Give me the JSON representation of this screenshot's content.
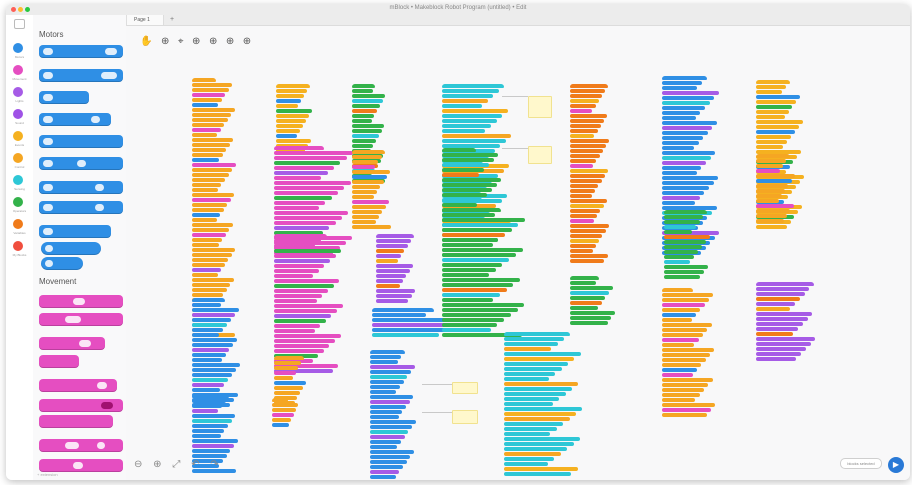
{
  "window": {
    "title": "mBlock • Makeblock Robot Program (untitled) • Edit",
    "traffic_lights": [
      "#ff5f57",
      "#febc2e",
      "#28c840"
    ]
  },
  "tabs": [
    {
      "label": "Page 1"
    }
  ],
  "add_tab_label": "+",
  "categories": [
    {
      "label": "Motors",
      "color": "#2f8fe5"
    },
    {
      "label": "Movement",
      "color": "#e54ec1"
    },
    {
      "label": "Lights",
      "color": "#a65be6"
    },
    {
      "label": "Sound",
      "color": "#9f52e6"
    },
    {
      "label": "Events",
      "color": "#f5b120"
    },
    {
      "label": "Control",
      "color": "#f5a623"
    },
    {
      "label": "Sensing",
      "color": "#2ec7d6"
    },
    {
      "label": "Operators",
      "color": "#33b24a"
    },
    {
      "label": "Variables",
      "color": "#f07b1a"
    },
    {
      "label": "My Blocks",
      "color": "#f04e3e"
    }
  ],
  "palette": {
    "section_motors": "Motors",
    "section_movement": "Movement",
    "bottom_label": "+ extension"
  },
  "toolbar": {
    "tools": [
      "✋",
      "⊕",
      "⌖",
      "⊕",
      "⊕",
      "⊕",
      "⊕"
    ]
  },
  "canvas_tools": [
    "⊖",
    "⊕",
    "⤢",
    "↶",
    "↷"
  ],
  "status_pill": "blocks selected",
  "run_button_icon": "▶",
  "colors": {
    "motors": "#2f8fe5",
    "movement": "#e54ec1",
    "lights": "#a65be6",
    "events": "#f5b120",
    "control": "#f5a623",
    "sensing": "#2ec7d6",
    "operators": "#33b24a",
    "variables": "#f07b1a",
    "myblocks": "#f04e3e",
    "note": "#fff8cc"
  }
}
